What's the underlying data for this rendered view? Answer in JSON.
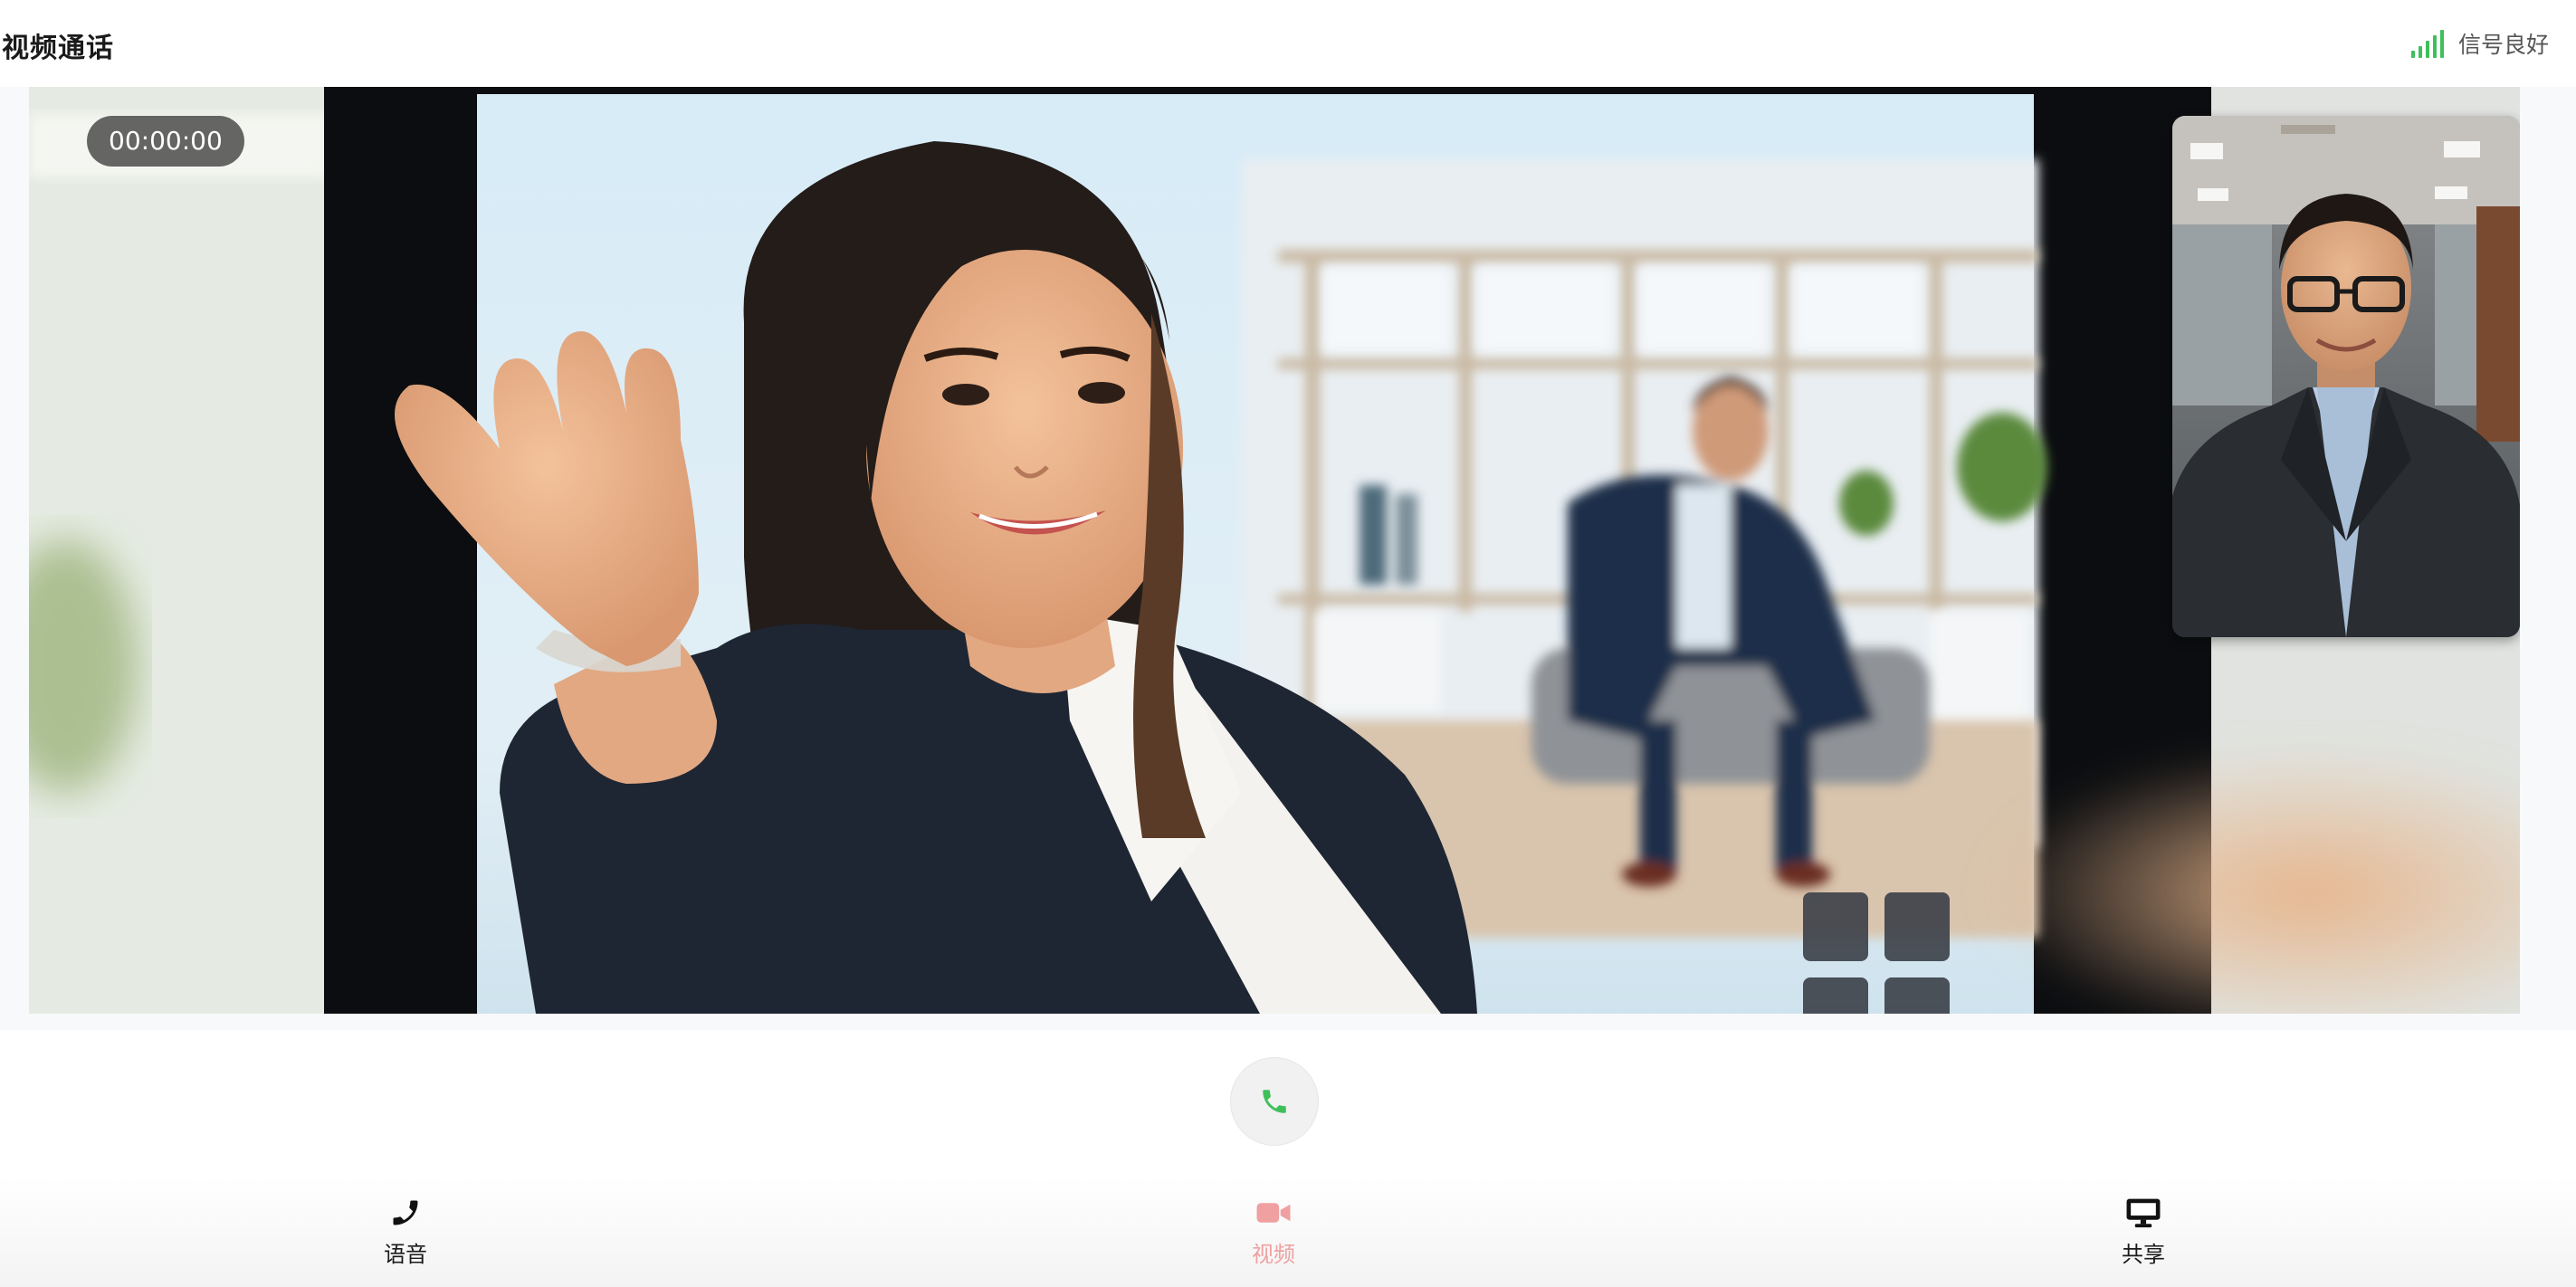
{
  "header": {
    "title": "视频通话",
    "signal_text": "信号良好"
  },
  "call": {
    "timer": "00:00:00"
  },
  "toolbar": {
    "items": [
      {
        "label": "语音",
        "icon": "phone-icon"
      },
      {
        "label": "视频",
        "icon": "video-camera-icon"
      },
      {
        "label": "共享",
        "icon": "monitor-icon"
      }
    ]
  },
  "colors": {
    "signal": "#3fbf5a",
    "call_button": "#3fbf5a",
    "video_active": "#f0a0a0"
  }
}
